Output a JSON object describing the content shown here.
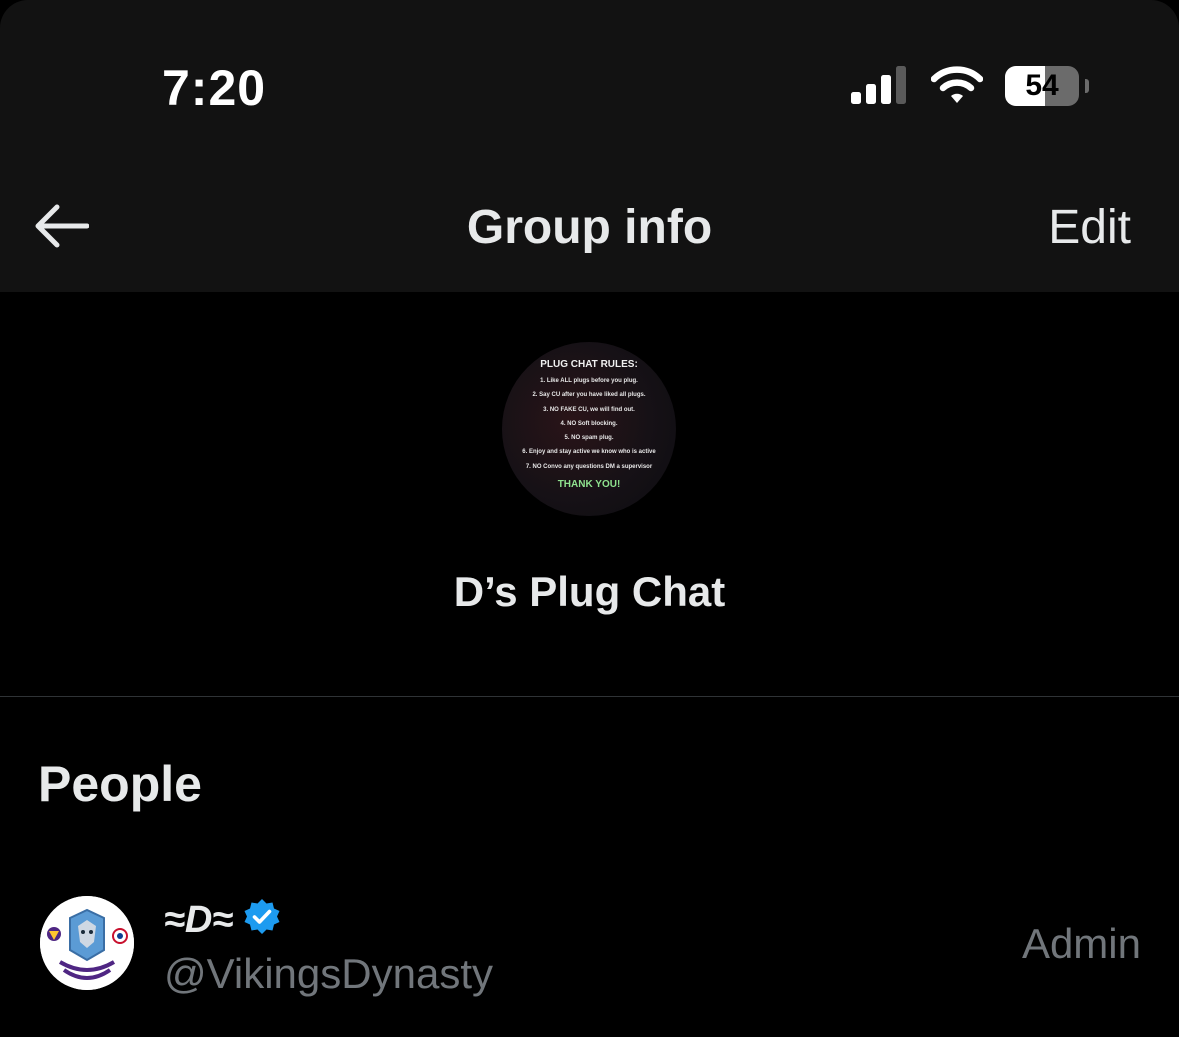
{
  "status_bar": {
    "time": "7:20",
    "battery_level": "54",
    "battery_fraction": 0.54,
    "signal_icon": "cellular-signal-icon",
    "wifi_icon": "wifi-icon"
  },
  "nav": {
    "back_icon": "back-arrow-icon",
    "title": "Group info",
    "edit_label": "Edit"
  },
  "group": {
    "avatar": {
      "heading": "PLUG CHAT RULES:",
      "rules": [
        "1. Like ALL plugs before you plug.",
        "2. Say CU after you have liked all plugs.",
        "3. NO FAKE CU, we will find out.",
        "4. NO Soft blocking.",
        "5. NO spam plug.",
        "6. Enjoy and stay active we know who is active",
        "7. NO Convo any questions DM a supervisor"
      ],
      "footer": "THANK YOU!"
    },
    "name": "D’s Plug Chat"
  },
  "people": {
    "title": "People",
    "members": [
      {
        "display_name": "≈D≈",
        "verified_icon": "verified-badge-icon",
        "handle": "@VikingsDynasty",
        "role": "Admin"
      }
    ]
  },
  "colors": {
    "background": "#000000",
    "header_background": "#121212",
    "primary_text": "#e7e9ea",
    "secondary_text": "#71767b",
    "divider": "#2f3336",
    "verified_blue": "#1d9bf0"
  }
}
